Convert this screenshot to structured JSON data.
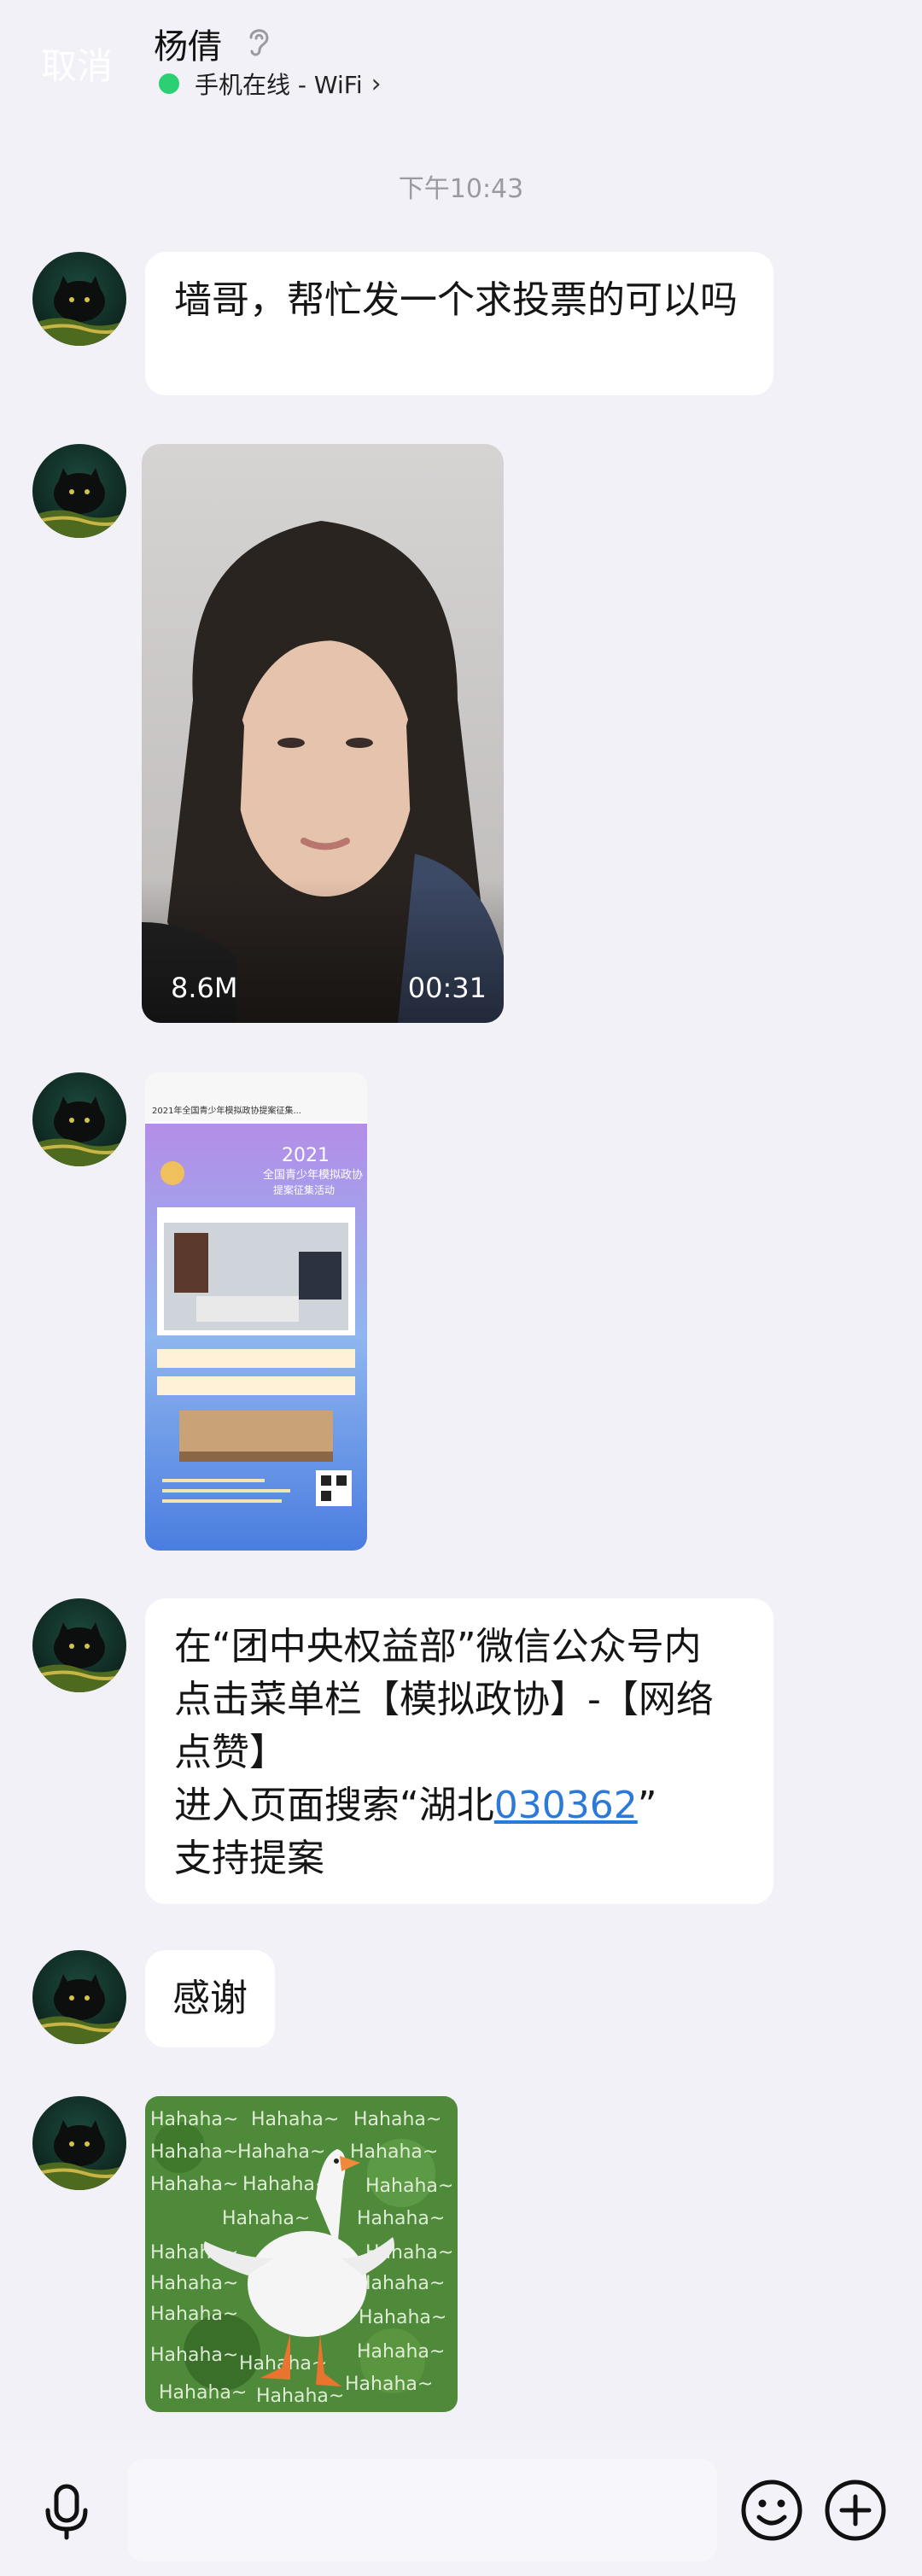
{
  "header": {
    "cancel_label": "取消",
    "contact_name": "杨倩",
    "status_text": "手机在线 - WiFi",
    "status_color": "#2ad071"
  },
  "timestamp": "下午10:43",
  "messages": [
    {
      "type": "text",
      "text": "墙哥，帮忙发一个求投票的可以吗"
    },
    {
      "type": "video",
      "size": "8.6M",
      "duration": "00:31"
    },
    {
      "type": "image",
      "poster_title": "2021年全国青少年模拟政协提案征集...",
      "poster_year": "2021",
      "poster_headline": "全国青少年模拟政协",
      "poster_sub": "提案征集活动"
    },
    {
      "type": "text",
      "lines": [
        "在“团中央权益部”微信公众号内",
        "点击菜单栏【模拟政协】-【网络",
        "点赞】",
        "进入页面搜索“湖北",
        "030362",
        "”",
        "支持提案"
      ]
    },
    {
      "type": "text",
      "text": "感谢"
    },
    {
      "type": "sticker",
      "caption_word": "Hahaha~"
    }
  ],
  "icons": {
    "voice": "microphone-icon",
    "emoji": "emoji-icon",
    "more": "plus-icon",
    "hearing": "ear-icon"
  }
}
